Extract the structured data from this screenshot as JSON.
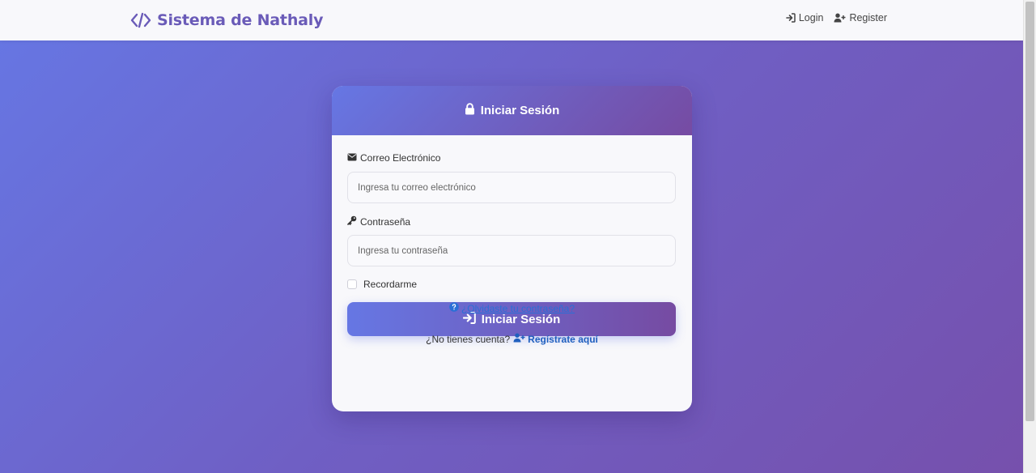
{
  "navbar": {
    "brand": "Sistema de Nathaly",
    "brand_icon": "code-icon",
    "links": [
      {
        "label": "Login",
        "icon": "sign-in-icon"
      },
      {
        "label": "Register",
        "icon": "user-plus-icon"
      }
    ]
  },
  "login_card": {
    "header_title": "Iniciar Sesión",
    "header_icon": "lock-icon",
    "email": {
      "label": "Correo Electrónico",
      "icon": "envelope-icon",
      "placeholder": "Ingresa tu correo electrónico",
      "value": ""
    },
    "password": {
      "label": "Contraseña",
      "icon": "key-icon",
      "placeholder": "Ingresa tu contraseña",
      "value": ""
    },
    "remember_label": "Recordarme",
    "remember_checked": false,
    "submit_label": "Iniciar Sesión",
    "forgot_link": "¿Olvidaste tu contraseña?",
    "no_account_text": "¿No tienes cuenta?",
    "register_link": "Regístrate aquí"
  },
  "colors": {
    "gradient_start": "#6677e4",
    "gradient_end": "#764ba2",
    "brand_text": "#6a5bb8",
    "link": "#2a6fd6"
  }
}
